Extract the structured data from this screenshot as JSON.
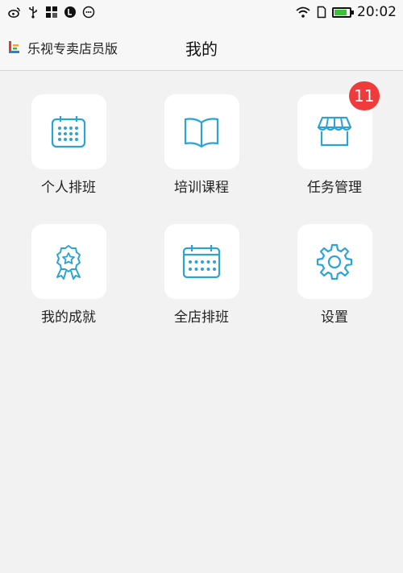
{
  "status_bar": {
    "time": "20:02",
    "left_icons": [
      "weibo-icon",
      "usb-icon",
      "app-grid-icon",
      "le-icon",
      "smile-icon"
    ],
    "right_icons": [
      "wifi-icon",
      "sim-icon",
      "battery-icon"
    ],
    "battery_level": 0.85,
    "battery_color": "#3fc03a"
  },
  "app_bar": {
    "brand_name": "乐视专卖店员版",
    "title": "我的"
  },
  "accent_color": "#2aa3d6",
  "badge_color": "#ef3b3b",
  "menu": [
    {
      "label": "个人排班",
      "icon": "calendar-icon"
    },
    {
      "label": "培训课程",
      "icon": "book-icon"
    },
    {
      "label": "任务管理",
      "icon": "store-icon",
      "badge": "11"
    },
    {
      "label": "我的成就",
      "icon": "award-icon"
    },
    {
      "label": "全店排班",
      "icon": "calendar-grid-icon"
    },
    {
      "label": "设置",
      "icon": "gear-icon"
    }
  ]
}
